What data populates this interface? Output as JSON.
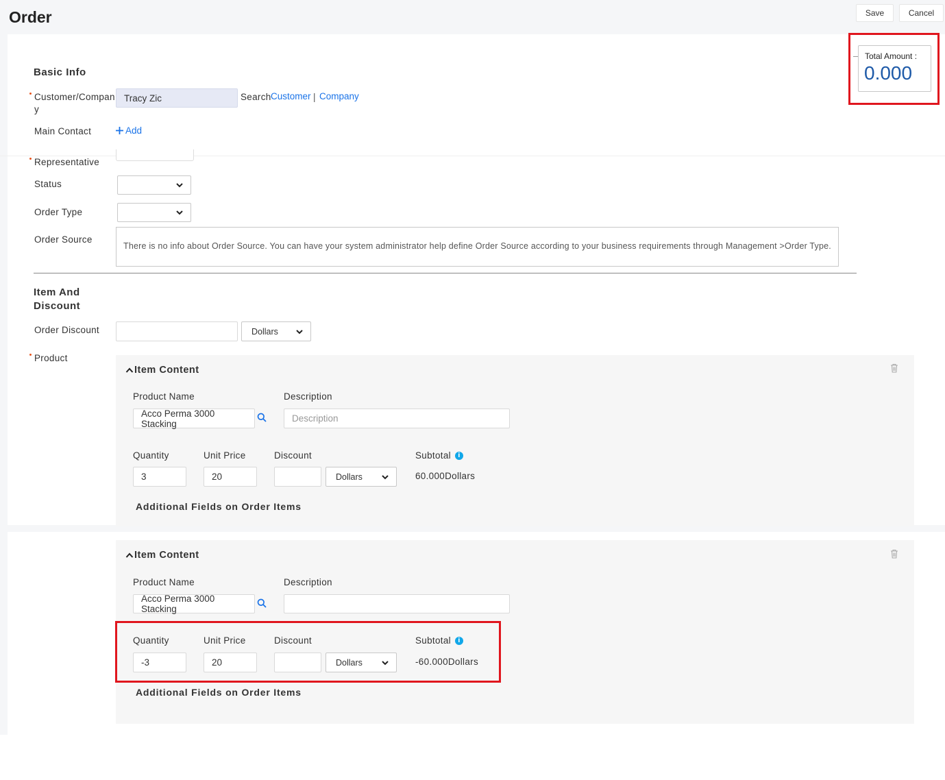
{
  "header": {
    "title": "Order",
    "save_label": "Save",
    "cancel_label": "Cancel"
  },
  "total": {
    "label": "Total Amount :",
    "value": "0.000"
  },
  "basic_info": {
    "title": "Basic Info",
    "customer_label_line1": "Customer/Compan",
    "customer_label_line2": "y",
    "customer_value": "Tracy Zic",
    "search_label": "Search",
    "search_customer": "Customer",
    "search_sep": "|",
    "search_company": "Company",
    "main_contact_label": "Main Contact",
    "add_label": "Add",
    "representative_label": "Representative",
    "status_label": "Status",
    "order_type_label": "Order Type",
    "order_source_label": "Order Source",
    "order_source_text": "There is no info about Order Source. You can have your system administrator help define Order Source according to your business requirements through Management >Order Type."
  },
  "item_discount": {
    "title_line1": "Item And",
    "title_line2": "Discount",
    "order_discount_label": "Order Discount",
    "order_discount_unit": "Dollars",
    "product_label": "Product"
  },
  "items": [
    {
      "header": "Item Content",
      "product_name_label": "Product Name",
      "product_name_value": "Acco Perma 3000 Stacking",
      "description_label": "Description",
      "description_placeholder": "Description",
      "quantity_label": "Quantity",
      "quantity_value": "3",
      "unit_price_label": "Unit Price",
      "unit_price_value": "20",
      "discount_label": "Discount",
      "discount_unit": "Dollars",
      "subtotal_label": "Subtotal",
      "subtotal_value": "60.000Dollars",
      "additional_label": "Additional Fields on Order Items"
    },
    {
      "header": "Item Content",
      "product_name_label": "Product Name",
      "product_name_value": "Acco Perma 3000 Stacking",
      "description_label": "Description",
      "description_placeholder": "",
      "quantity_label": "Quantity",
      "quantity_value": "-3",
      "unit_price_label": "Unit Price",
      "unit_price_value": "20",
      "discount_label": "Discount",
      "discount_unit": "Dollars",
      "subtotal_label": "Subtotal",
      "subtotal_value": "-60.000Dollars",
      "additional_label": "Additional Fields on Order Items"
    }
  ],
  "colors": {
    "accent": "#1a73e8",
    "highlight": "#e0161e",
    "total_value": "#1e5aa8",
    "info": "#11a7e9"
  }
}
